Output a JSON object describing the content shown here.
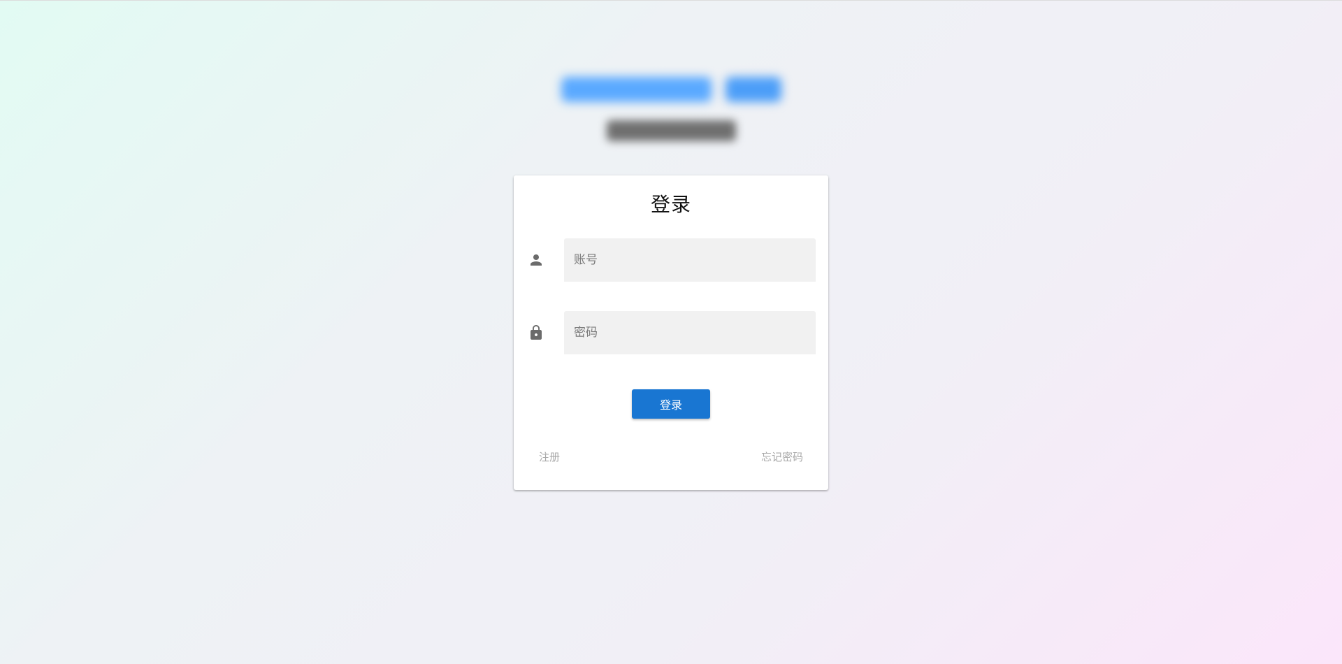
{
  "login_card": {
    "title": "登录",
    "username_placeholder": "账号",
    "password_placeholder": "密码",
    "submit_label": "登录",
    "register_link": "注册",
    "forgot_link": "忘记密码"
  },
  "icons": {
    "username": "person-icon",
    "password": "lock-icon"
  },
  "colors": {
    "primary": "#1976d2",
    "input_bg": "#f1f1f1",
    "link_text": "#a8a8a8"
  }
}
